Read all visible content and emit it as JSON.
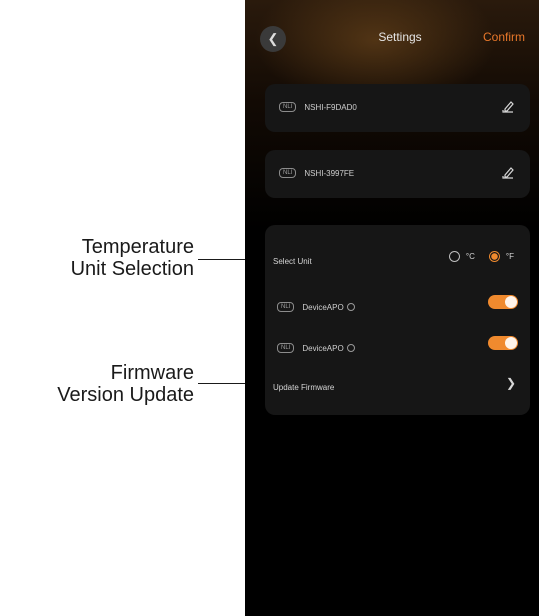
{
  "callouts": {
    "temperature": [
      "Temperature",
      "Unit Selection"
    ],
    "firmware": [
      "Firmware",
      "Version Update"
    ]
  },
  "header": {
    "back_icon": "back-chevron-icon",
    "title": "Settings",
    "confirm": "Confirm"
  },
  "devices": [
    {
      "tag": "NLI",
      "name": "NSHI-F9DAD0",
      "edit_icon": "edit-icon"
    },
    {
      "tag": "NLI",
      "name": "NSHI-3997FE",
      "edit_icon": "edit-icon"
    }
  ],
  "settings": {
    "unit": {
      "label": "Select Unit",
      "options": [
        {
          "label": "°C",
          "selected": false
        },
        {
          "label": "°F",
          "selected": true
        }
      ]
    },
    "toggles": [
      {
        "tag": "NLI",
        "label": "DeviceAPO",
        "on": true
      },
      {
        "tag": "NLI",
        "label": "DeviceAPO",
        "on": true
      }
    ],
    "firmware": {
      "label": "Update Firmware",
      "icon": "chevron-right-icon"
    }
  },
  "colors": {
    "accent": "#f08a2e",
    "background": "#000000",
    "card": "#161616"
  }
}
